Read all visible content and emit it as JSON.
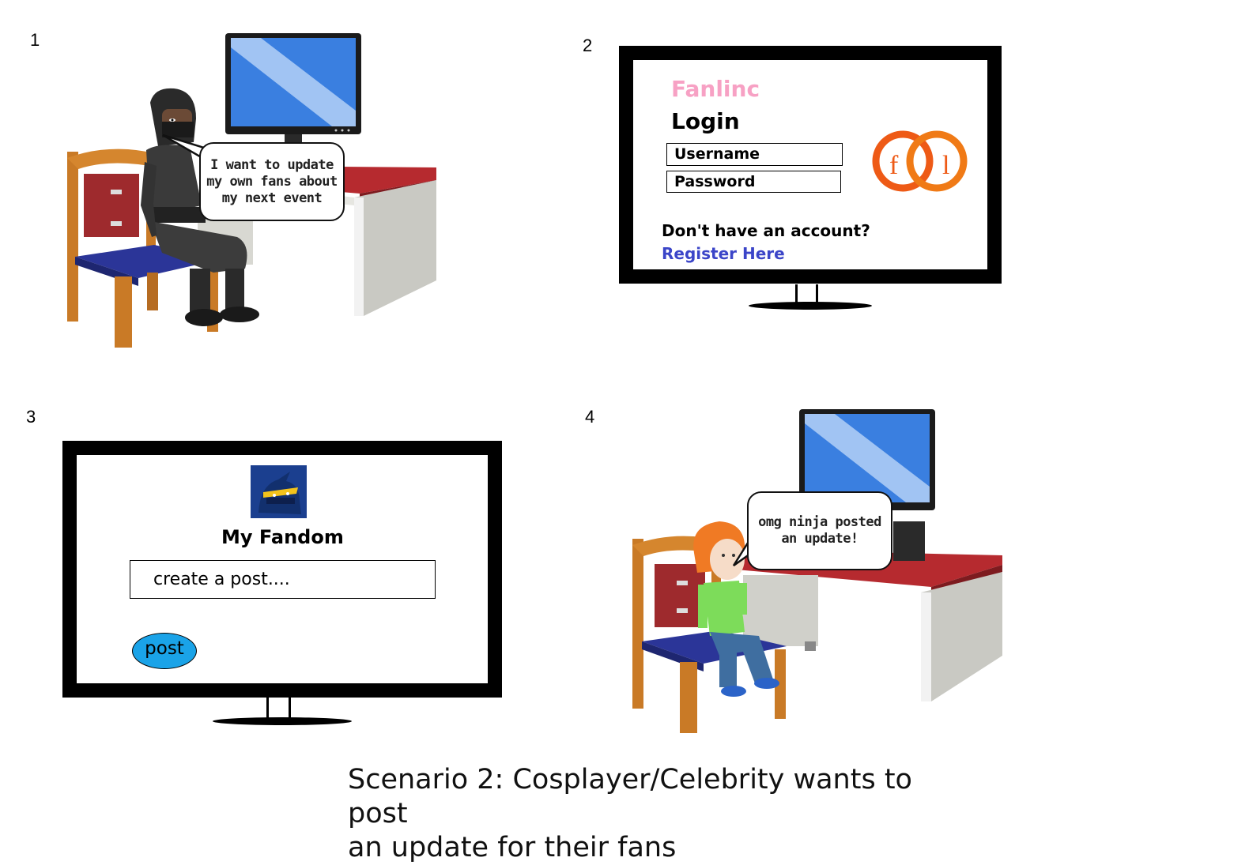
{
  "panels": {
    "p1": {
      "number": "1",
      "speech": "I want to update my own fans about my next event"
    },
    "p2": {
      "number": "2",
      "brand": "Fanlinc",
      "login_title": "Login",
      "username_placeholder": "Username",
      "password_placeholder": "Password",
      "no_account_text": "Don't have an account?",
      "register_link": "Register Here",
      "logo_letters": "f l",
      "colors": {
        "brand_pink": "#f7a1c4",
        "logo_orange": "#ee5a16",
        "link_blue": "#3b45c8"
      }
    },
    "p3": {
      "number": "3",
      "page_title": "My Fandom",
      "post_input_placeholder": "create a post....",
      "post_button": "post",
      "colors": {
        "post_button_fill": "#1aa3e8",
        "avatar_bg": "#1b3f8f"
      }
    },
    "p4": {
      "number": "4",
      "speech": "omg ninja posted an update!"
    }
  },
  "caption": {
    "line1": "Scenario 2: Cosplayer/Celebrity wants to post",
    "line2": "an update for their fans"
  }
}
